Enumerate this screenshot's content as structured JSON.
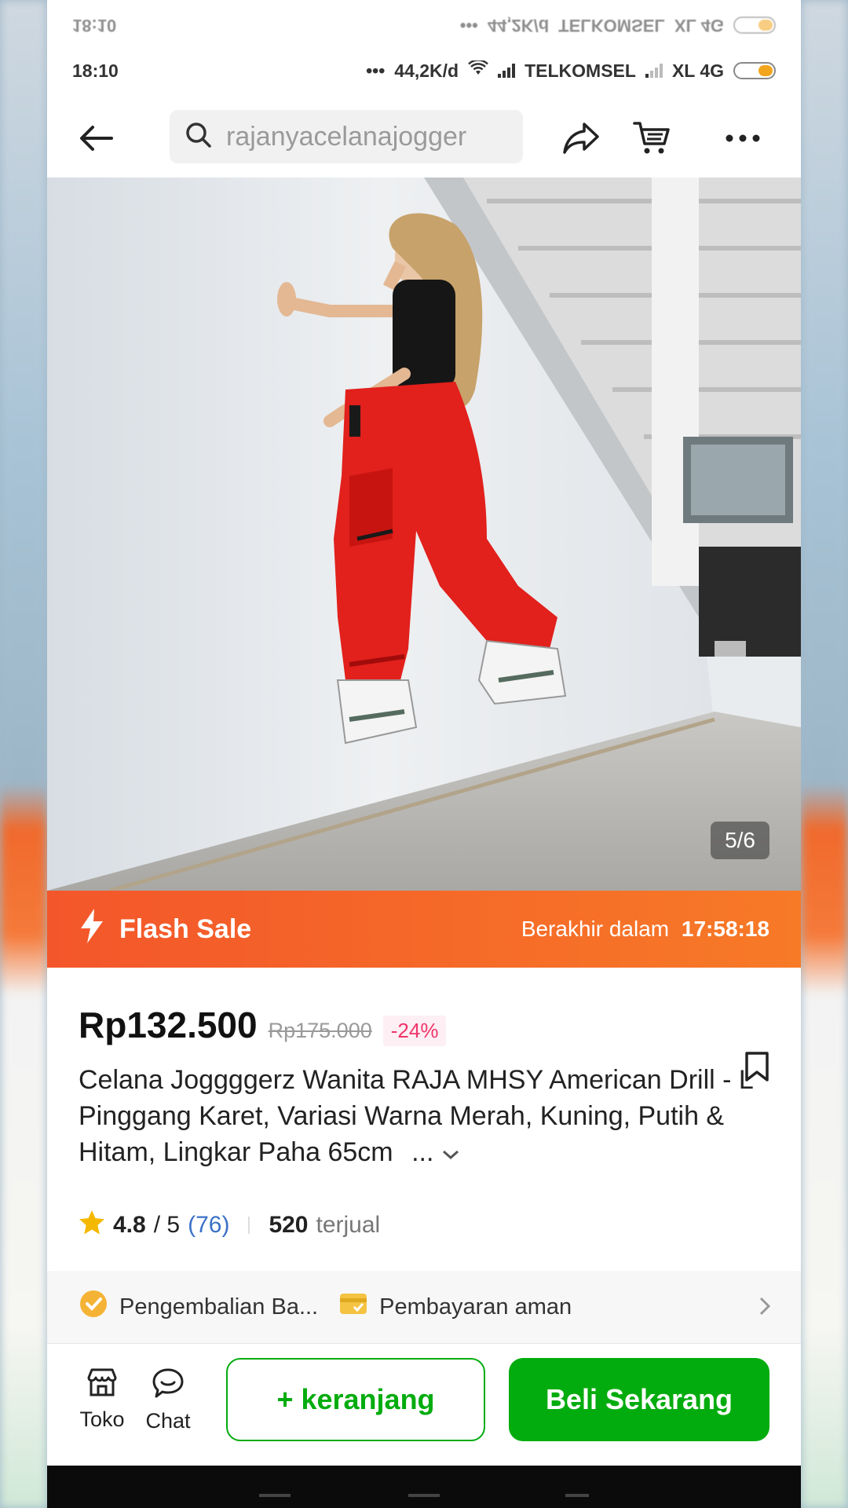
{
  "status_bar": {
    "time": "18:10",
    "speed": "44,2K/d",
    "carrier1": "TELKOMSEL",
    "carrier2": "XL 4G",
    "dots": "•••"
  },
  "ghost_status": {
    "time": "18:10",
    "speed": "44,2K/d",
    "carrier1": "TELKOMSEL",
    "carrier2": "XL 4G",
    "dots": "•••"
  },
  "header": {
    "search_value": "rajanyacelanajogger"
  },
  "product": {
    "image_counter": "5/6",
    "flash_sale_label": "Flash Sale",
    "ends_label": "Berakhir dalam",
    "countdown": "17:58:18",
    "price": "Rp132.500",
    "original_price": "Rp175.000",
    "discount": "-24%",
    "title": "Celana Joggggerz Wanita RAJA MHSY American Drill - L Pinggang Karet, Variasi Warna Merah, Kuning, Putih & Hitam, Lingkar Paha 65cm",
    "title_more": "...",
    "rating": "4.8",
    "rating_max": "/ 5",
    "review_count": "(76)",
    "sold_count": "520",
    "sold_label": "terjual"
  },
  "benefits": [
    {
      "label": "Pengembalian Ba...",
      "icon": "return-badge-icon",
      "color": "#f5b335"
    },
    {
      "label": "Pembayaran aman",
      "icon": "secure-payment-icon",
      "color": "#f5c342"
    }
  ],
  "bottom_bar": {
    "shop_label": "Toko",
    "chat_label": "Chat",
    "cart_label": "+ keranjang",
    "buy_label": "Beli Sekarang"
  },
  "colors": {
    "accent_green": "#03ac0e",
    "flash_orange": "#f3562a",
    "discount_pink": "#f0346b",
    "star_yellow": "#f5b800",
    "link_blue": "#3b71c8"
  }
}
